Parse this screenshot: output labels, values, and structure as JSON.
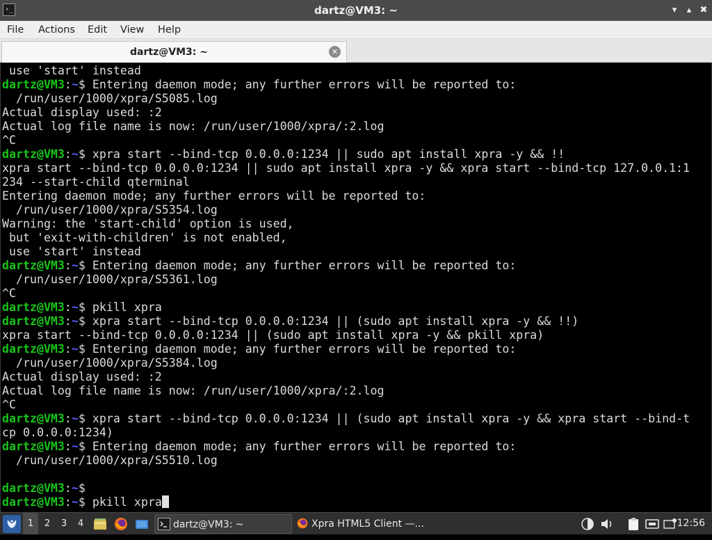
{
  "window": {
    "title": "dartz@VM3: ~",
    "app_icon_glyph": "›_",
    "min_glyph": "▾",
    "max_glyph": "▴",
    "close_glyph": "✖"
  },
  "menubar": {
    "file": "File",
    "actions": "Actions",
    "edit": "Edit",
    "view": "View",
    "help": "Help"
  },
  "tab": {
    "label": "dartz@VM3: ~",
    "close_glyph": "✕"
  },
  "terminal": {
    "colors": {
      "user": "#18c418",
      "path": "#5a5aff",
      "text": "#dcdcdc",
      "background": "#000000"
    },
    "lines": [
      {
        "text": " use 'start' instead"
      },
      {
        "user": "dartz@VM3",
        "path": "~",
        "text": "$ Entering daemon mode; any further errors will be reported to:"
      },
      {
        "text": "  /run/user/1000/xpra/S5085.log"
      },
      {
        "text": "Actual display used: :2"
      },
      {
        "text": "Actual log file name is now: /run/user/1000/xpra/:2.log"
      },
      {
        "text": "^C"
      },
      {
        "user": "dartz@VM3",
        "path": "~",
        "text": "$ xpra start --bind-tcp 0.0.0.0:1234 || sudo apt install xpra -y && !!"
      },
      {
        "text": "xpra start --bind-tcp 0.0.0.0:1234 || sudo apt install xpra -y && xpra start --bind-tcp 127.0.0.1:1"
      },
      {
        "text": "234 --start-child qterminal"
      },
      {
        "text": "Entering daemon mode; any further errors will be reported to:"
      },
      {
        "text": "  /run/user/1000/xpra/S5354.log"
      },
      {
        "text": "Warning: the 'start-child' option is used,"
      },
      {
        "text": " but 'exit-with-children' is not enabled,"
      },
      {
        "text": " use 'start' instead"
      },
      {
        "user": "dartz@VM3",
        "path": "~",
        "text": "$ Entering daemon mode; any further errors will be reported to:"
      },
      {
        "text": "  /run/user/1000/xpra/S5361.log"
      },
      {
        "text": "^C"
      },
      {
        "user": "dartz@VM3",
        "path": "~",
        "text": "$ pkill xpra"
      },
      {
        "user": "dartz@VM3",
        "path": "~",
        "text": "$ xpra start --bind-tcp 0.0.0.0:1234 || (sudo apt install xpra -y && !!)"
      },
      {
        "text": "xpra start --bind-tcp 0.0.0.0:1234 || (sudo apt install xpra -y && pkill xpra)"
      },
      {
        "user": "dartz@VM3",
        "path": "~",
        "text": "$ Entering daemon mode; any further errors will be reported to:"
      },
      {
        "text": "  /run/user/1000/xpra/S5384.log"
      },
      {
        "text": "Actual display used: :2"
      },
      {
        "text": "Actual log file name is now: /run/user/1000/xpra/:2.log"
      },
      {
        "text": "^C"
      },
      {
        "user": "dartz@VM3",
        "path": "~",
        "text": "$ xpra start --bind-tcp 0.0.0.0:1234 || (sudo apt install xpra -y && xpra start --bind-t"
      },
      {
        "text": "cp 0.0.0.0:1234)"
      },
      {
        "user": "dartz@VM3",
        "path": "~",
        "text": "$ Entering daemon mode; any further errors will be reported to:"
      },
      {
        "text": "  /run/user/1000/xpra/S5510.log"
      },
      {
        "text": ""
      },
      {
        "user": "dartz@VM3",
        "path": "~",
        "text": "$"
      },
      {
        "user": "dartz@VM3",
        "path": "~",
        "text": "$ pkill xpra",
        "cursor": true
      }
    ]
  },
  "taskbar": {
    "workspaces": [
      "1",
      "2",
      "3",
      "4"
    ],
    "active_workspace": "1",
    "tasks": [
      {
        "label": "dartz@VM3: ~",
        "icon": "terminal-icon",
        "active": true
      },
      {
        "label": "Xpra HTML5 Client —...",
        "icon": "firefox-icon",
        "active": false
      }
    ],
    "clock": "12:56"
  }
}
